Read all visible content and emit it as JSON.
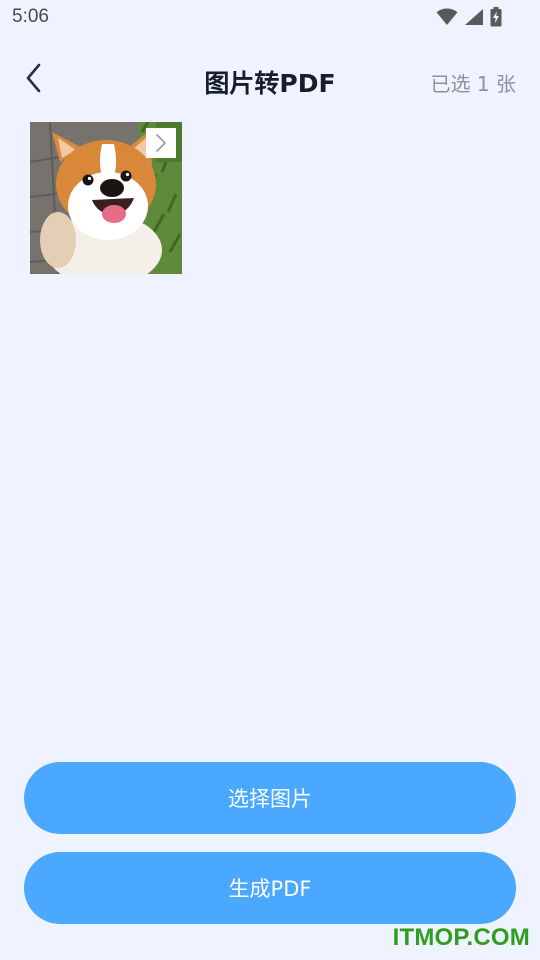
{
  "status_bar": {
    "time": "5:06",
    "icons": [
      "wifi-icon",
      "cellular-signal-icon",
      "battery-charging-icon"
    ]
  },
  "header": {
    "back_icon": "chevron-left-icon",
    "title": "图片转PDF",
    "selected_count": "已选 1 张"
  },
  "images": [
    {
      "subject": "corgi-photo",
      "action_icon": "chevron-right-icon"
    }
  ],
  "actions": {
    "select_images": "选择图片",
    "generate_pdf": "生成PDF"
  },
  "watermark": "ITMOP.COM",
  "colors": {
    "background": "#eef3ff",
    "button": "#4aa8ff",
    "title": "#161d2b",
    "muted": "#8c919c",
    "watermark": "#2f9e1f"
  }
}
